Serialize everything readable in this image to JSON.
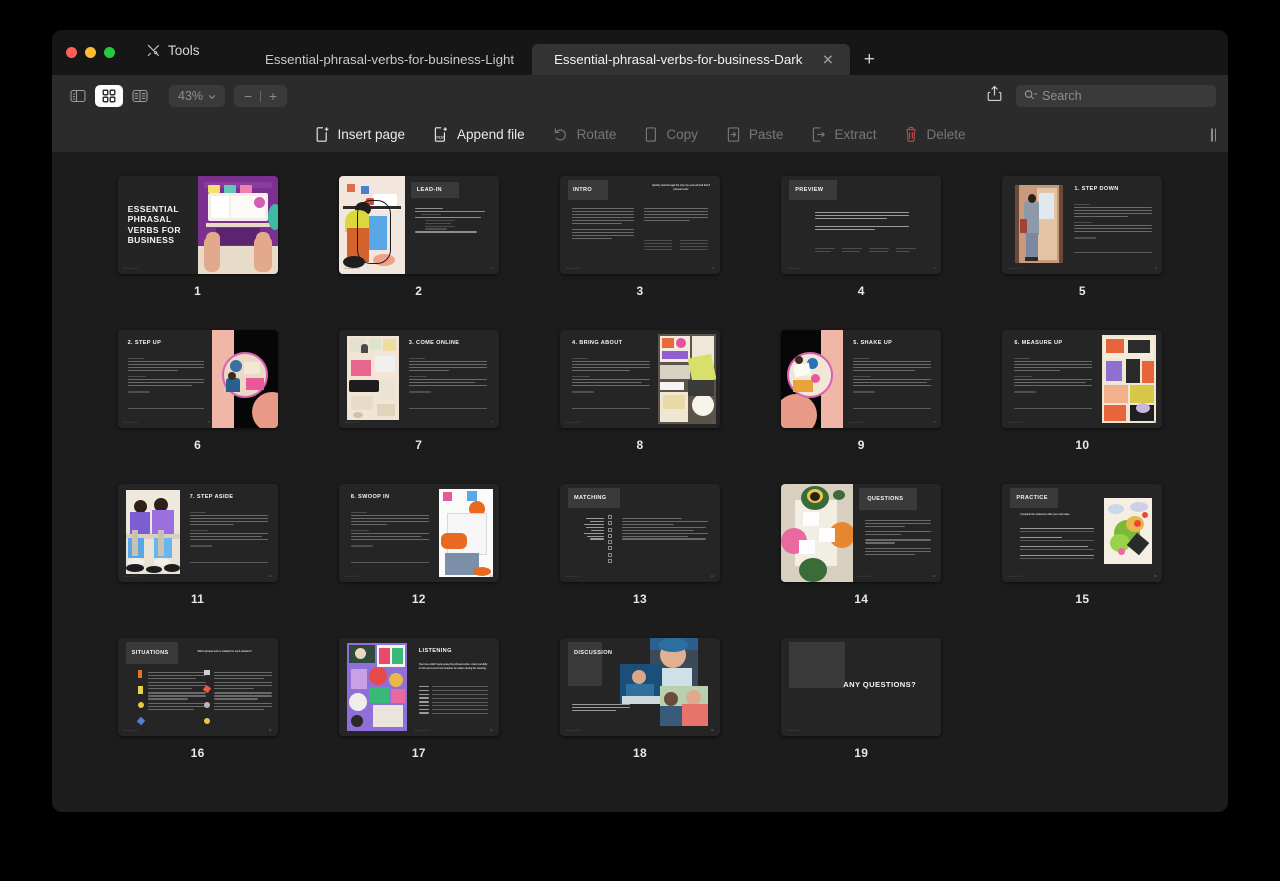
{
  "window": {
    "traffic_lights": [
      "close",
      "minimize",
      "maximize"
    ],
    "tools_label": "Tools",
    "tabs": [
      {
        "label": "Essential-phrasal-verbs-for-business-Light",
        "active": false,
        "closable": false
      },
      {
        "label": "Essential-phrasal-verbs-for-business-Dark",
        "active": true,
        "closable": true
      }
    ],
    "new_tab_label": "+"
  },
  "toolbar": {
    "view_modes": [
      {
        "name": "sidebar-view",
        "active": false
      },
      {
        "name": "grid-view",
        "active": true
      },
      {
        "name": "page-text-view",
        "active": false
      }
    ],
    "zoom_level": "43%",
    "zoom_out_label": "−",
    "zoom_in_label": "+",
    "share_label": "Share",
    "search": {
      "placeholder": "Search",
      "value": ""
    }
  },
  "actions": [
    {
      "label": "Insert page",
      "icon": "insert-page-icon",
      "enabled": true
    },
    {
      "label": "Append file",
      "icon": "append-pdf-icon",
      "enabled": true
    },
    {
      "label": "Rotate",
      "icon": "rotate-icon",
      "enabled": false
    },
    {
      "label": "Copy",
      "icon": "copy-icon",
      "enabled": false
    },
    {
      "label": "Paste",
      "icon": "paste-icon",
      "enabled": false
    },
    {
      "label": "Extract",
      "icon": "extract-icon",
      "enabled": false
    },
    {
      "label": "Delete",
      "icon": "trash-icon",
      "enabled": false
    }
  ],
  "document": {
    "title": "Essential-phrasal-verbs-for-business-Dark",
    "page_count": 19,
    "pages": [
      {
        "number": "1",
        "kind": "cover",
        "title": "ESSENTIAL PHRASAL VERBS FOR BUSINESS",
        "image_side": "right"
      },
      {
        "number": "2",
        "kind": "section",
        "title": "LEAD-IN",
        "image_side": "left"
      },
      {
        "number": "3",
        "kind": "two-column",
        "title": "INTRO",
        "subtitle": "Quickly read through the story by yourself and find 8 phrasal verbs",
        "image_side": "none"
      },
      {
        "number": "4",
        "kind": "text",
        "title": "PREVIEW",
        "image_side": "none"
      },
      {
        "number": "5",
        "kind": "verb",
        "title": "1. STEP DOWN",
        "image_side": "left"
      },
      {
        "number": "6",
        "kind": "verb",
        "title": "2. STEP UP",
        "image_side": "right"
      },
      {
        "number": "7",
        "kind": "verb",
        "title": "3. COME ONLINE",
        "image_side": "left"
      },
      {
        "number": "8",
        "kind": "verb",
        "title": "4. BRING ABOUT",
        "image_side": "right"
      },
      {
        "number": "9",
        "kind": "verb",
        "title": "5. SHAKE UP",
        "image_side": "left"
      },
      {
        "number": "10",
        "kind": "verb",
        "title": "6. MEASURE UP",
        "image_side": "right"
      },
      {
        "number": "11",
        "kind": "verb",
        "title": "7. STEP ASIDE",
        "image_side": "left"
      },
      {
        "number": "12",
        "kind": "verb",
        "title": "8. SWOOP IN",
        "image_side": "right"
      },
      {
        "number": "13",
        "kind": "matching",
        "title": "MATCHING",
        "image_side": "none"
      },
      {
        "number": "14",
        "kind": "questions",
        "title": "QUESTIONS",
        "image_side": "left"
      },
      {
        "number": "15",
        "kind": "practice",
        "title": "PRACTICE",
        "subtitle": "Complete the sentences with your own ideas",
        "image_side": "right"
      },
      {
        "number": "16",
        "kind": "situations",
        "title": "SITUATIONS",
        "subtitle": "Which phrasal verb is suitable for each situation?",
        "image_side": "none"
      },
      {
        "number": "17",
        "kind": "listening",
        "title": "LISTENING",
        "subtitle": "Your boss didn't quite grasp the phrasal verbs. Listen carefully to him and correct the mistakes he makes during the meeting.",
        "image_side": "left"
      },
      {
        "number": "18",
        "kind": "discussion",
        "title": "DISCUSSION",
        "subtitle": "What phrasal verb does each picture make you think of? Explain and describe additional details.",
        "image_side": "right"
      },
      {
        "number": "19",
        "kind": "closing",
        "title": "ANY QUESTIONS?",
        "image_side": "none"
      }
    ]
  },
  "colors": {
    "window_bg": "#1c1c1c",
    "titlebar_bg": "#161616",
    "toolbar_bg": "#2b2b2b",
    "active_tab_bg": "#333333",
    "slide_bg": "#252525",
    "accent_delete": "#b24a4a",
    "text_primary": "#e9e9e9",
    "text_disabled": "#767676"
  }
}
